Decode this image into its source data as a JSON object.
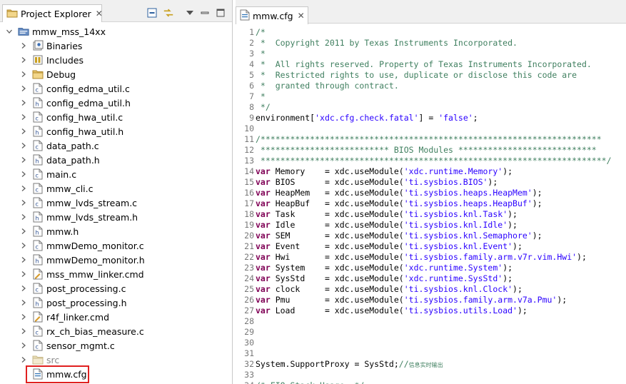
{
  "left_panel": {
    "tab_label": "Project Explorer",
    "tree": [
      {
        "label": "mmw_mss_14xx",
        "icon": "project-icon",
        "chevron": "down",
        "indent": 0
      },
      {
        "label": "Binaries",
        "icon": "binaries-icon",
        "chevron": "right",
        "indent": 1
      },
      {
        "label": "Includes",
        "icon": "includes-icon",
        "chevron": "right",
        "indent": 1
      },
      {
        "label": "Debug",
        "icon": "folder-icon",
        "chevron": "right",
        "indent": 1
      },
      {
        "label": "config_edma_util.c",
        "icon": "c-file-icon",
        "chevron": "right",
        "indent": 1
      },
      {
        "label": "config_edma_util.h",
        "icon": "h-file-icon",
        "chevron": "right",
        "indent": 1
      },
      {
        "label": "config_hwa_util.c",
        "icon": "c-file-icon",
        "chevron": "right",
        "indent": 1
      },
      {
        "label": "config_hwa_util.h",
        "icon": "h-file-icon",
        "chevron": "right",
        "indent": 1
      },
      {
        "label": "data_path.c",
        "icon": "c-file-icon",
        "chevron": "right",
        "indent": 1
      },
      {
        "label": "data_path.h",
        "icon": "h-file-icon",
        "chevron": "right",
        "indent": 1
      },
      {
        "label": "main.c",
        "icon": "c-file-icon",
        "chevron": "right",
        "indent": 1
      },
      {
        "label": "mmw_cli.c",
        "icon": "c-file-icon",
        "chevron": "right",
        "indent": 1
      },
      {
        "label": "mmw_lvds_stream.c",
        "icon": "c-file-icon",
        "chevron": "right",
        "indent": 1
      },
      {
        "label": "mmw_lvds_stream.h",
        "icon": "h-file-icon",
        "chevron": "right",
        "indent": 1
      },
      {
        "label": "mmw.h",
        "icon": "h-file-icon",
        "chevron": "right",
        "indent": 1
      },
      {
        "label": "mmwDemo_monitor.c",
        "icon": "c-file-icon",
        "chevron": "right",
        "indent": 1
      },
      {
        "label": "mmwDemo_monitor.h",
        "icon": "h-file-icon",
        "chevron": "right",
        "indent": 1
      },
      {
        "label": "mss_mmw_linker.cmd",
        "icon": "cmd-file-icon",
        "chevron": "right",
        "indent": 1
      },
      {
        "label": "post_processing.c",
        "icon": "c-file-icon",
        "chevron": "right",
        "indent": 1
      },
      {
        "label": "post_processing.h",
        "icon": "h-file-icon",
        "chevron": "right",
        "indent": 1
      },
      {
        "label": "r4f_linker.cmd",
        "icon": "cmd-file-icon",
        "chevron": "right",
        "indent": 1
      },
      {
        "label": "rx_ch_bias_measure.c",
        "icon": "c-file-icon",
        "chevron": "right",
        "indent": 1
      },
      {
        "label": "sensor_mgmt.c",
        "icon": "c-file-icon",
        "chevron": "right",
        "indent": 1
      },
      {
        "label": "src",
        "icon": "folder-excluded-icon",
        "chevron": "right",
        "indent": 1,
        "dim": true
      },
      {
        "label": "mmw.cfg",
        "icon": "cfg-file-icon",
        "chevron": "none",
        "indent": 1
      }
    ]
  },
  "editor": {
    "tab_label": "mmw.cfg",
    "lines": [
      {
        "n": "1",
        "tokens": [
          [
            "c",
            "/*"
          ]
        ]
      },
      {
        "n": "2",
        "tokens": [
          [
            "c",
            " *  Copyright 2011 by Texas Instruments Incorporated."
          ]
        ]
      },
      {
        "n": "3",
        "tokens": [
          [
            "c",
            " *"
          ]
        ]
      },
      {
        "n": "4",
        "tokens": [
          [
            "c",
            " *  All rights reserved. Property of Texas Instruments Incorporated."
          ]
        ]
      },
      {
        "n": "5",
        "tokens": [
          [
            "c",
            " *  Restricted rights to use, duplicate or disclose this code are"
          ]
        ]
      },
      {
        "n": "6",
        "tokens": [
          [
            "c",
            " *  granted through contract."
          ]
        ]
      },
      {
        "n": "7",
        "tokens": [
          [
            "c",
            " *"
          ]
        ]
      },
      {
        "n": "8",
        "tokens": [
          [
            "c",
            " */"
          ]
        ]
      },
      {
        "n": "9",
        "tokens": [
          [
            "p",
            "environment["
          ],
          [
            "s",
            "'xdc.cfg.check.fatal'"
          ],
          [
            "p",
            "] = "
          ],
          [
            "s",
            "'false'"
          ],
          [
            "p",
            ";"
          ]
        ]
      },
      {
        "n": "10",
        "tokens": []
      },
      {
        "n": "11",
        "tokens": [
          [
            "c",
            "/*********************************************************************"
          ]
        ]
      },
      {
        "n": "12",
        "tokens": [
          [
            "c",
            " ************************** BIOS Modules ****************************"
          ]
        ]
      },
      {
        "n": "13",
        "tokens": [
          [
            "c",
            " **********************************************************************/"
          ]
        ]
      },
      {
        "n": "14",
        "tokens": [
          [
            "k",
            "var"
          ],
          [
            "p",
            " Memory    = xdc.useModule("
          ],
          [
            "s",
            "'xdc.runtime.Memory'"
          ],
          [
            "p",
            ");"
          ]
        ]
      },
      {
        "n": "15",
        "tokens": [
          [
            "k",
            "var"
          ],
          [
            "p",
            " BIOS      = xdc.useModule("
          ],
          [
            "s",
            "'ti.sysbios.BIOS'"
          ],
          [
            "p",
            ");"
          ]
        ]
      },
      {
        "n": "16",
        "tokens": [
          [
            "k",
            "var"
          ],
          [
            "p",
            " HeapMem   = xdc.useModule("
          ],
          [
            "s",
            "'ti.sysbios.heaps.HeapMem'"
          ],
          [
            "p",
            ");"
          ]
        ]
      },
      {
        "n": "17",
        "tokens": [
          [
            "k",
            "var"
          ],
          [
            "p",
            " HeapBuf   = xdc.useModule("
          ],
          [
            "s",
            "'ti.sysbios.heaps.HeapBuf'"
          ],
          [
            "p",
            ");"
          ]
        ]
      },
      {
        "n": "18",
        "tokens": [
          [
            "k",
            "var"
          ],
          [
            "p",
            " Task      = xdc.useModule("
          ],
          [
            "s",
            "'ti.sysbios.knl.Task'"
          ],
          [
            "p",
            ");"
          ]
        ]
      },
      {
        "n": "19",
        "tokens": [
          [
            "k",
            "var"
          ],
          [
            "p",
            " Idle      = xdc.useModule("
          ],
          [
            "s",
            "'ti.sysbios.knl.Idle'"
          ],
          [
            "p",
            ");"
          ]
        ]
      },
      {
        "n": "20",
        "tokens": [
          [
            "k",
            "var"
          ],
          [
            "p",
            " SEM       = xdc.useModule("
          ],
          [
            "s",
            "'ti.sysbios.knl.Semaphore'"
          ],
          [
            "p",
            ");"
          ]
        ]
      },
      {
        "n": "21",
        "tokens": [
          [
            "k",
            "var"
          ],
          [
            "p",
            " Event     = xdc.useModule("
          ],
          [
            "s",
            "'ti.sysbios.knl.Event'"
          ],
          [
            "p",
            ");"
          ]
        ]
      },
      {
        "n": "22",
        "tokens": [
          [
            "k",
            "var"
          ],
          [
            "p",
            " Hwi       = xdc.useModule("
          ],
          [
            "s",
            "'ti.sysbios.family.arm.v7r.vim.Hwi'"
          ],
          [
            "p",
            ");"
          ]
        ]
      },
      {
        "n": "23",
        "tokens": [
          [
            "k",
            "var"
          ],
          [
            "p",
            " System    = xdc.useModule("
          ],
          [
            "s",
            "'xdc.runtime.System'"
          ],
          [
            "p",
            ");"
          ]
        ]
      },
      {
        "n": "24",
        "tokens": [
          [
            "k",
            "var"
          ],
          [
            "p",
            " SysStd    = xdc.useModule("
          ],
          [
            "s",
            "'xdc.runtime.SysStd'"
          ],
          [
            "p",
            ");"
          ]
        ]
      },
      {
        "n": "25",
        "tokens": [
          [
            "k",
            "var"
          ],
          [
            "p",
            " clock     = xdc.useModule("
          ],
          [
            "s",
            "'ti.sysbios.knl.Clock'"
          ],
          [
            "p",
            ");"
          ]
        ]
      },
      {
        "n": "26",
        "tokens": [
          [
            "k",
            "var"
          ],
          [
            "p",
            " Pmu       = xdc.useModule("
          ],
          [
            "s",
            "'ti.sysbios.family.arm.v7a.Pmu'"
          ],
          [
            "p",
            ");"
          ]
        ]
      },
      {
        "n": "27",
        "tokens": [
          [
            "k",
            "var"
          ],
          [
            "p",
            " Load      = xdc.useModule("
          ],
          [
            "s",
            "'ti.sysbios.utils.Load'"
          ],
          [
            "p",
            ");"
          ]
        ]
      },
      {
        "n": "28",
        "tokens": []
      },
      {
        "n": "29",
        "tokens": []
      },
      {
        "n": "30",
        "tokens": []
      },
      {
        "n": "31",
        "tokens": []
      },
      {
        "n": "32",
        "tokens": [
          [
            "p",
            "System.SupportProxy = SysStd;"
          ],
          [
            "c",
            "//"
          ],
          [
            "z",
            "信息实时输出"
          ]
        ]
      },
      {
        "n": "33",
        "tokens": []
      },
      {
        "n": "34",
        "tokens": [
          [
            "c",
            "/* FIQ Stack Usage: */"
          ]
        ]
      }
    ]
  },
  "colors": {
    "comment": "#3f7f5f",
    "keyword": "#7f0055",
    "string": "#2a00ff",
    "line_number": "#787878",
    "selection_box": "#e02020"
  }
}
